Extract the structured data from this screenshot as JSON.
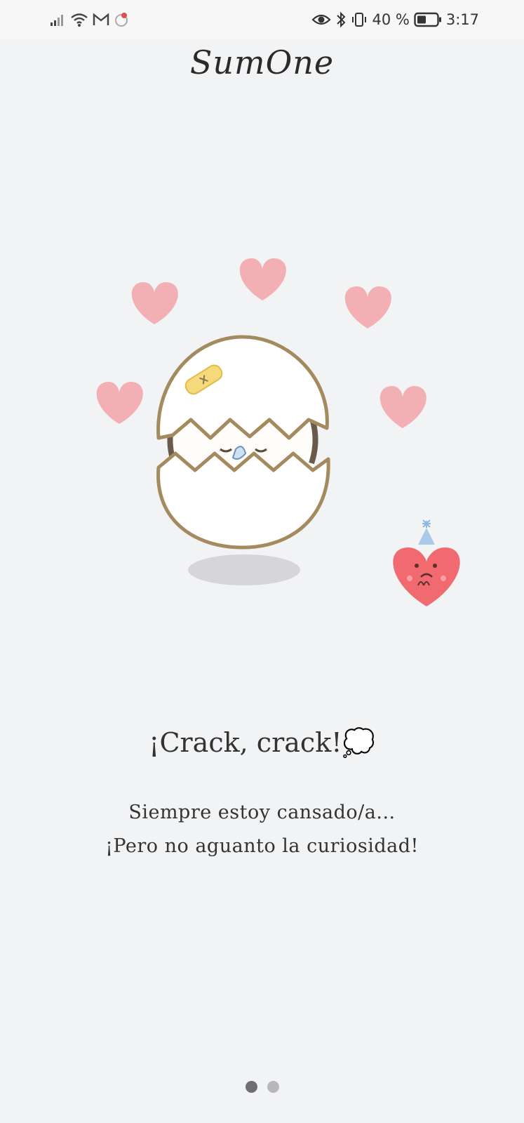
{
  "status_bar": {
    "battery_percent": "40 %",
    "time": "3:17",
    "icons": [
      "signal-icon",
      "wifi-icon",
      "gmail-icon",
      "notification-icon",
      "eye-icon",
      "bluetooth-icon",
      "vibrate-icon",
      "battery-icon"
    ]
  },
  "header": {
    "title": "SumOne"
  },
  "illustration": {
    "description_icons": [
      "heart-icon",
      "cracked-egg-character",
      "sad-heart-character",
      "bandage-icon"
    ]
  },
  "content": {
    "headline": "¡Crack, crack!💭",
    "lines": [
      "Siempre estoy cansado/a...",
      "¡Pero no aguanto la curiosidad!"
    ]
  },
  "pagination": {
    "count": 2,
    "active_index": 0
  },
  "colors": {
    "background": "#f2f3f5",
    "heart_pink": "#f2a9ad",
    "heart_red": "#f06a6f",
    "egg_outline": "#a48a5f"
  }
}
